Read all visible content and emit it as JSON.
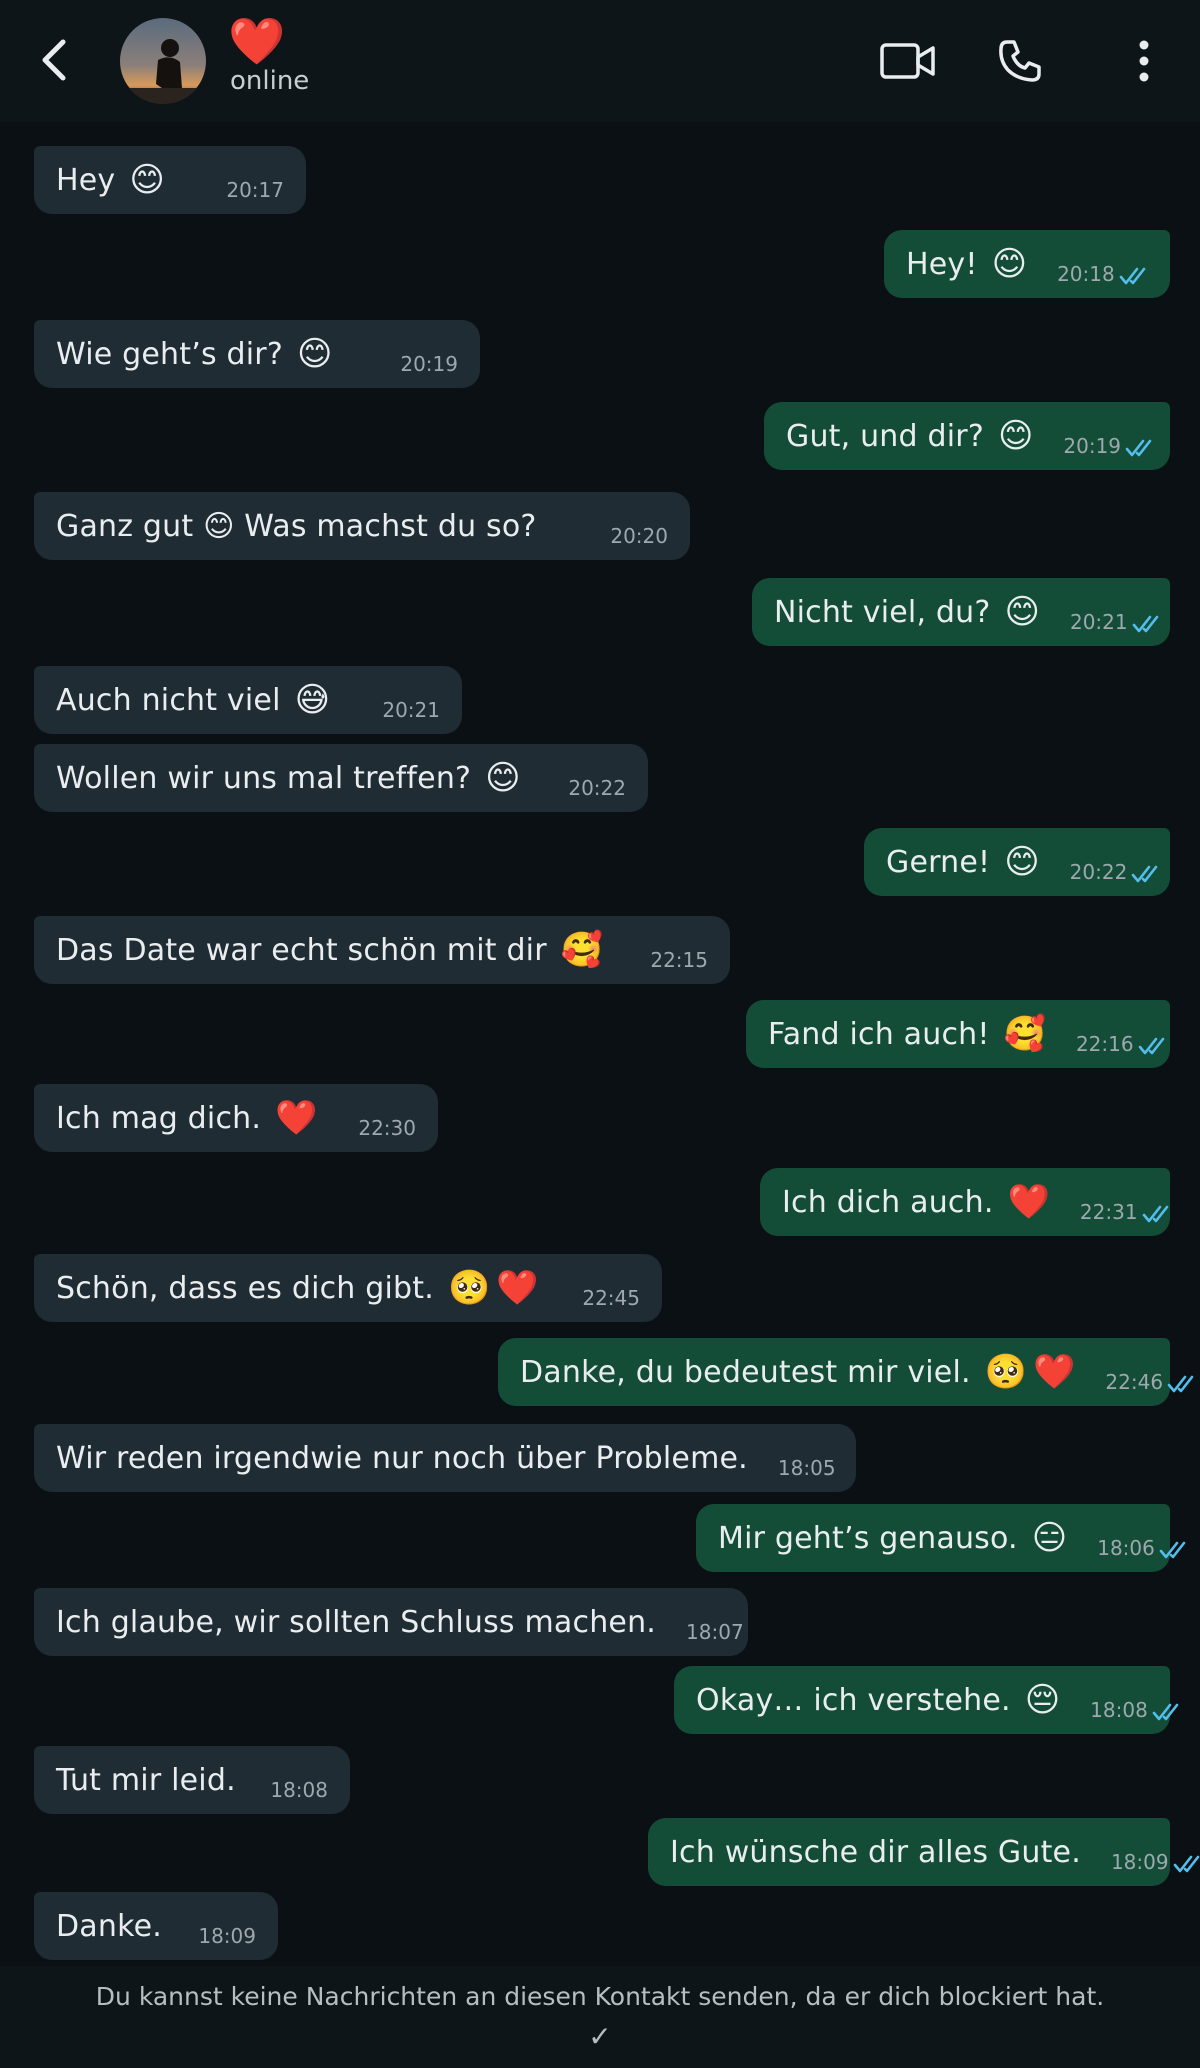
{
  "header": {
    "contact_name": "❤️",
    "status": "online",
    "icons": [
      "back-arrow-icon",
      "video-call-icon",
      "phone-icon",
      "more-options-icon"
    ]
  },
  "messages": [
    {
      "dir": "in",
      "text": "Hey",
      "emoji": [
        "😊"
      ],
      "time": "20:17"
    },
    {
      "dir": "out",
      "text": "Hey!",
      "emoji": [
        "😊"
      ],
      "time": "20:18",
      "read": true
    },
    {
      "dir": "in",
      "text": "Wie geht’s dir?",
      "emoji": [
        "😊"
      ],
      "time": "20:19"
    },
    {
      "dir": "out",
      "text": "Gut, und dir?",
      "emoji": [
        "😊"
      ],
      "time": "20:19",
      "read": true
    },
    {
      "dir": "in",
      "text": "Ganz gut 😊 Was machst du so?",
      "emoji": [],
      "time": "20:20"
    },
    {
      "dir": "out",
      "text": "Nicht viel, du?",
      "emoji": [
        "😊"
      ],
      "time": "20:21",
      "read": true
    },
    {
      "dir": "in",
      "text": "Auch nicht viel",
      "emoji": [
        "😅"
      ],
      "time": "20:21"
    },
    {
      "dir": "in",
      "text": "Wollen wir uns mal treffen?",
      "emoji": [
        "😊"
      ],
      "time": "20:22"
    },
    {
      "dir": "out",
      "text": "Gerne!",
      "emoji": [
        "😊"
      ],
      "time": "20:22",
      "read": true
    },
    {
      "dir": "in",
      "text": "Das Date war echt schön mit dir",
      "emoji": [
        "🥰"
      ],
      "time": "22:15"
    },
    {
      "dir": "out",
      "text": "Fand ich auch!",
      "emoji": [
        "🥰"
      ],
      "time": "22:16",
      "read": true
    },
    {
      "dir": "in",
      "text": "Ich mag dich.",
      "emoji": [
        "❤️"
      ],
      "time": "22:30"
    },
    {
      "dir": "out",
      "text": "Ich dich auch.",
      "emoji": [
        "❤️"
      ],
      "time": "22:31",
      "read": true
    },
    {
      "dir": "in",
      "text": "Schön, dass es dich gibt.",
      "emoji": [
        "🥺",
        "❤️"
      ],
      "time": "22:45"
    },
    {
      "dir": "out",
      "text": "Danke, du bedeutest mir viel.",
      "emoji": [
        "🥺",
        "❤️"
      ],
      "time": "22:46",
      "read": true
    },
    {
      "dir": "in",
      "text": "Wir reden irgendwie nur noch über Probleme.",
      "emoji": [],
      "time": "18:05"
    },
    {
      "dir": "out",
      "text": "Mir geht’s genauso.",
      "emoji": [
        "😑"
      ],
      "time": "18:06",
      "read": true
    },
    {
      "dir": "in",
      "text": "Ich glaube, wir sollten Schluss machen.",
      "emoji": [],
      "time": "18:07"
    },
    {
      "dir": "out",
      "text": "Okay… ich verstehe.",
      "emoji": [
        "😔"
      ],
      "time": "18:08",
      "read": true
    },
    {
      "dir": "in",
      "text": "Tut mir leid.",
      "emoji": [],
      "time": "18:08"
    },
    {
      "dir": "out",
      "text": "Ich wünsche dir alles Gute.",
      "emoji": [],
      "time": "18:09",
      "read": true
    },
    {
      "dir": "in",
      "text": "Danke.",
      "emoji": [],
      "time": "18:09"
    }
  ],
  "footer": {
    "notice": "Du kannst keine Nachrichten an diesen Kontakt senden, da er dich blockiert hat.",
    "check": "✓"
  },
  "colors": {
    "background": "#0b1014",
    "header": "#0e1519",
    "incoming_bubble": "#1f2c33",
    "outgoing_bubble": "#134d37",
    "read_ticks": "#53bdeb",
    "name_heart": "#ff2a3b"
  }
}
